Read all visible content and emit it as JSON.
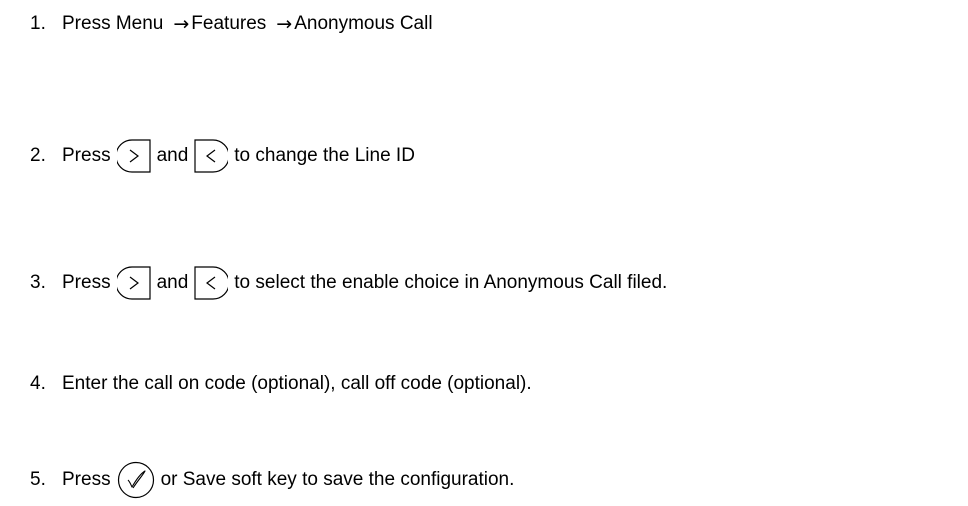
{
  "steps": [
    {
      "number": "1.",
      "parts": [
        "Press Menu",
        "→",
        "Features",
        "→",
        "Anonymous Call"
      ]
    },
    {
      "number": "2.",
      "press": "Press",
      "and": "and",
      "rest": "to change the Line ID",
      "icons": [
        "right-arrow-key-icon",
        "left-arrow-key-icon"
      ]
    },
    {
      "number": "3.",
      "press": "Press",
      "and": "and",
      "rest": "to select the enable choice in Anonymous Call filed.",
      "icons": [
        "right-arrow-key-icon",
        "left-arrow-key-icon"
      ]
    },
    {
      "number": "4.",
      "text": "Enter the call on code (optional), call off code (optional)."
    },
    {
      "number": "5.",
      "press": "Press",
      "rest": "or Save soft key to save the configuration.",
      "icons": [
        "ok-key-icon"
      ]
    }
  ]
}
